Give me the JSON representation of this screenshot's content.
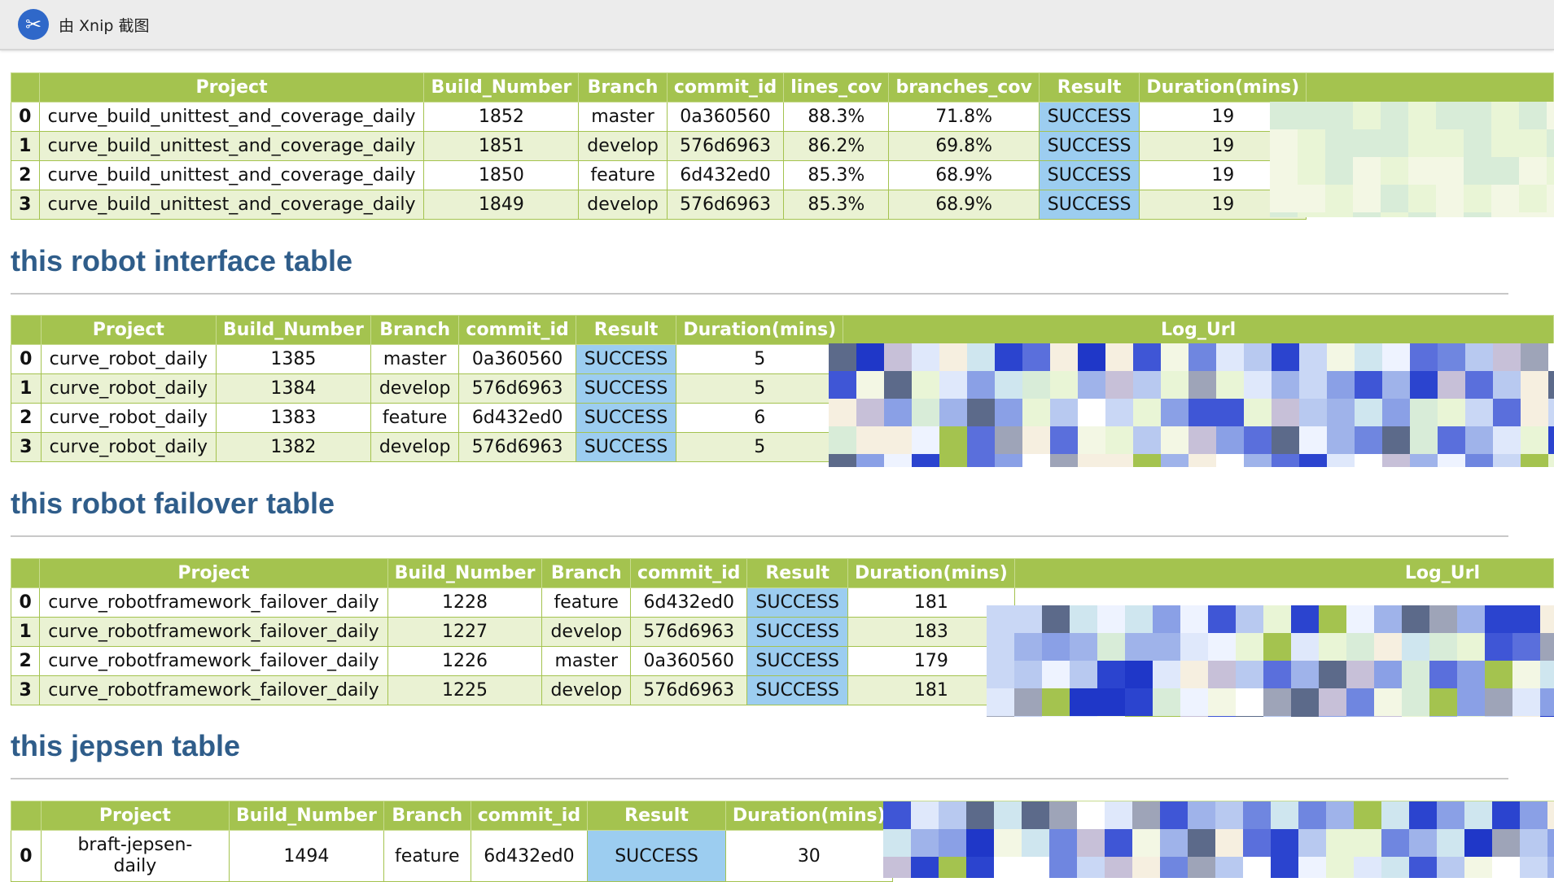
{
  "window": {
    "title": "由 Xnip 截图",
    "logo_glyph": "✂"
  },
  "coverage_table": {
    "headers": [
      "",
      "Project",
      "Build_Number",
      "Branch",
      "commit_id",
      "lines_cov",
      "branches_cov",
      "Result",
      "Duration(mins)"
    ],
    "rows": [
      {
        "idx": "0",
        "project": "curve_build_unittest_and_coverage_daily",
        "build": "1852",
        "branch": "master",
        "commit": "0a360560",
        "lines": "88.3%",
        "branches": "71.8%",
        "result": "SUCCESS",
        "duration": "19",
        "link": "h"
      },
      {
        "idx": "1",
        "project": "curve_build_unittest_and_coverage_daily",
        "build": "1851",
        "branch": "develop",
        "commit": "576d6963",
        "lines": "86.2%",
        "branches": "69.8%",
        "result": "SUCCESS",
        "duration": "19",
        "link": ""
      },
      {
        "idx": "2",
        "project": "curve_build_unittest_and_coverage_daily",
        "build": "1850",
        "branch": "feature",
        "commit": "6d432ed0",
        "lines": "85.3%",
        "branches": "68.9%",
        "result": "SUCCESS",
        "duration": "19",
        "link": ""
      },
      {
        "idx": "3",
        "project": "curve_build_unittest_and_coverage_daily",
        "build": "1849",
        "branch": "develop",
        "commit": "576d6963",
        "lines": "85.3%",
        "branches": "68.9%",
        "result": "SUCCESS",
        "duration": "19",
        "link": "htt"
      }
    ]
  },
  "robot_interface": {
    "title": "this robot interface table",
    "headers": [
      "",
      "Project",
      "Build_Number",
      "Branch",
      "commit_id",
      "Result",
      "Duration(mins)",
      "Log_Url"
    ],
    "rows": [
      {
        "idx": "0",
        "project": "curve_robot_daily",
        "build": "1385",
        "branch": "master",
        "commit": "0a360560",
        "result": "SUCCESS",
        "duration": "5",
        "link": ""
      },
      {
        "idx": "1",
        "project": "curve_robot_daily",
        "build": "1384",
        "branch": "develop",
        "commit": "576d6963",
        "result": "SUCCESS",
        "duration": "5",
        "link": ""
      },
      {
        "idx": "2",
        "project": "curve_robot_daily",
        "build": "1383",
        "branch": "feature",
        "commit": "6d432ed0",
        "result": "SUCCESS",
        "duration": "6",
        "link": ""
      },
      {
        "idx": "3",
        "project": "curve_robot_daily",
        "build": "1382",
        "branch": "develop",
        "commit": "576d6963",
        "result": "SUCCESS",
        "duration": "5",
        "link": "h"
      }
    ]
  },
  "robot_failover": {
    "title": "this robot failover table",
    "headers": [
      "",
      "Project",
      "Build_Number",
      "Branch",
      "commit_id",
      "Result",
      "Duration(mins)",
      "Log_Url"
    ],
    "rows": [
      {
        "idx": "0",
        "project": "curve_robotframework_failover_daily",
        "build": "1228",
        "branch": "feature",
        "commit": "6d432ed0",
        "result": "SUCCESS",
        "duration": "181"
      },
      {
        "idx": "1",
        "project": "curve_robotframework_failover_daily",
        "build": "1227",
        "branch": "develop",
        "commit": "576d6963",
        "result": "SUCCESS",
        "duration": "183"
      },
      {
        "idx": "2",
        "project": "curve_robotframework_failover_daily",
        "build": "1226",
        "branch": "master",
        "commit": "0a360560",
        "result": "SUCCESS",
        "duration": "179"
      },
      {
        "idx": "3",
        "project": "curve_robotframework_failover_daily",
        "build": "1225",
        "branch": "develop",
        "commit": "576d6963",
        "result": "SUCCESS",
        "duration": "181"
      }
    ]
  },
  "jepsen": {
    "title": "this jepsen table",
    "headers": [
      "",
      "Project",
      "Build_Number",
      "Branch",
      "commit_id",
      "Result",
      "Duration(mins)"
    ],
    "rows": [
      {
        "idx": "0",
        "project_line1": "braft-jepsen-",
        "project_line2": "daily",
        "build": "1494",
        "branch": "feature",
        "commit": "6d432ed0",
        "result": "SUCCESS",
        "duration": "30",
        "link": "htt"
      }
    ]
  },
  "colors": {
    "header_green": "#a4c34f",
    "row_alt": "#eaf2d3",
    "result_blue": "#9ccdf0",
    "title_blue": "#2f5d8a",
    "link_blue": "#1f3fd8"
  }
}
